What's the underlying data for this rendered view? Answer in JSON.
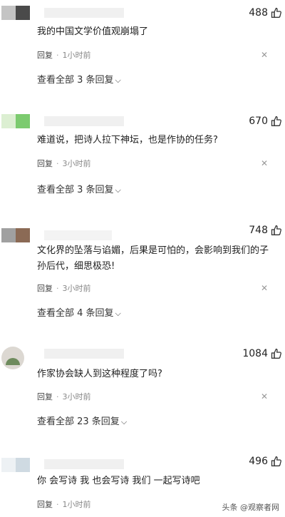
{
  "comments": [
    {
      "likes": "488",
      "text": "我的中国文学价值观崩塌了",
      "reply_label": "回复",
      "time": "1小时前",
      "view_replies": "查看全部 3 条回复",
      "avatar_colors": [
        "#bfbfbf",
        "#4a4a4a"
      ]
    },
    {
      "likes": "670",
      "text": "难道说，把诗人拉下神坛，也是作协的任务?",
      "reply_label": "回复",
      "time": "3小时前",
      "view_replies": "查看全部 3 条回复",
      "avatar_colors": [
        "#d8eccd",
        "#7cc86e"
      ]
    },
    {
      "likes": "748",
      "text": "文化界的坠落与谄媚，后果是可怕的，会影响到我们的子孙后代，细思极恐!",
      "reply_label": "回复",
      "time": "3小时前",
      "view_replies": "查看全部 4 条回复",
      "avatar_colors": [
        "#9a9a9a",
        "#8b6a55"
      ]
    },
    {
      "likes": "1084",
      "text": "作家协会缺人到这种程度了吗?",
      "reply_label": "回复",
      "time": "3小时前",
      "view_replies": "查看全部 23 条回复",
      "avatar_colors": [
        "#d9d5cf",
        "#6e8b5d"
      ]
    },
    {
      "likes": "496",
      "text": "你 会写诗 我 也会写诗 我们 一起写诗吧",
      "reply_label": "回复",
      "time": "1小时前",
      "avatar_colors": [
        "#e9eef2",
        "#cdd8e0"
      ]
    }
  ],
  "watermark": "头条 @观察者网",
  "icons": {
    "like": "thumbs-up-icon",
    "close": "close-icon",
    "expand": "chevron-down-icon"
  }
}
